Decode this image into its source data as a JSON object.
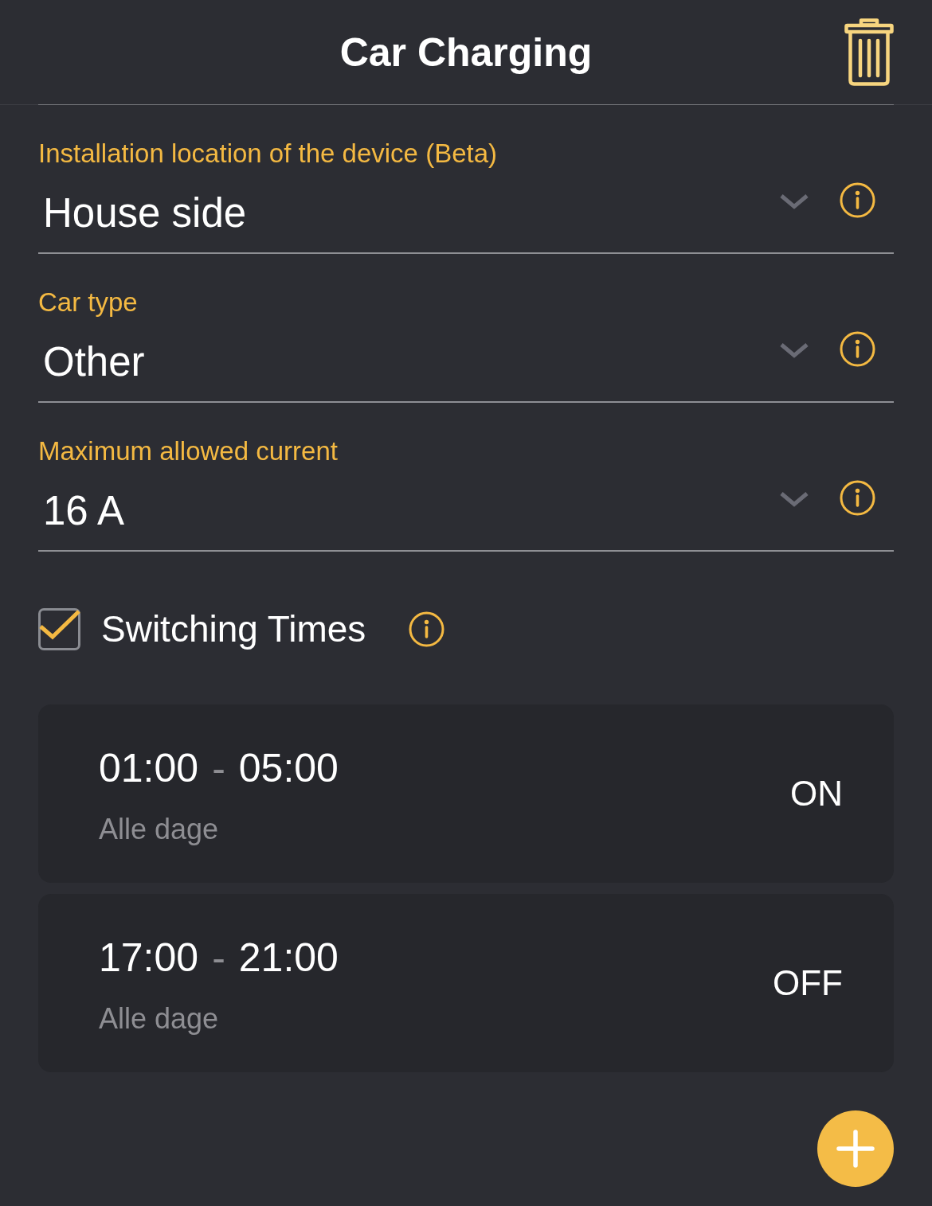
{
  "header": {
    "title": "Car Charging"
  },
  "fields": [
    {
      "label": "Installation location of the device (Beta)",
      "value": "House side"
    },
    {
      "label": "Car type",
      "value": "Other"
    },
    {
      "label": "Maximum allowed current",
      "value": "16 A"
    }
  ],
  "switching_times": {
    "label": "Switching Times",
    "checked": true
  },
  "schedules": [
    {
      "start": "01:00",
      "separator": "-",
      "end": "05:00",
      "days": "Alle dage",
      "state": "ON"
    },
    {
      "start": "17:00",
      "separator": "-",
      "end": "21:00",
      "days": "Alle dage",
      "state": "OFF"
    }
  ]
}
